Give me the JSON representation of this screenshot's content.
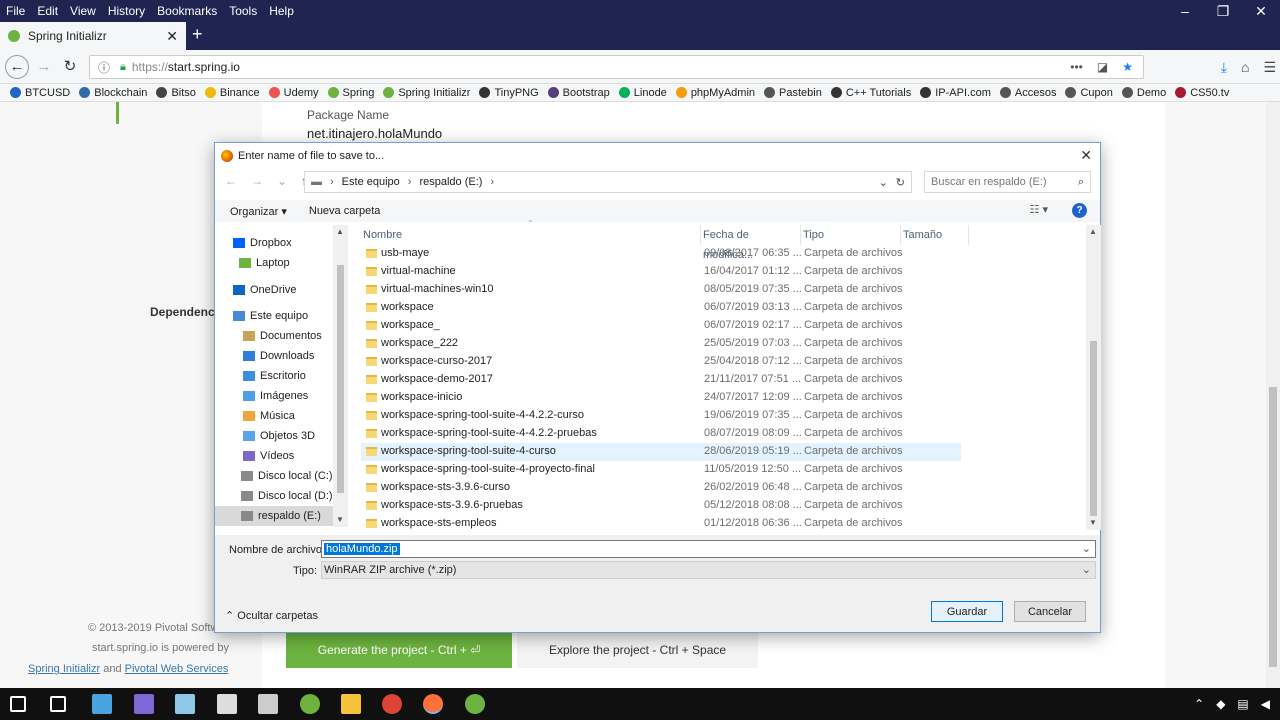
{
  "menu": [
    "File",
    "Edit",
    "View",
    "History",
    "Bookmarks",
    "Tools",
    "Help"
  ],
  "tab": {
    "title": "Spring Initializr"
  },
  "url": {
    "protocol": "https://",
    "host": "start.spring.io"
  },
  "bookmarks": [
    {
      "label": "BTCUSD",
      "color": "#1f64c8"
    },
    {
      "label": "Blockchain",
      "color": "#2e6da4"
    },
    {
      "label": "Bitso",
      "color": "#444444"
    },
    {
      "label": "Binance",
      "color": "#f0b90b"
    },
    {
      "label": "Udemy",
      "color": "#ec5252"
    },
    {
      "label": "Spring",
      "color": "#6db33f"
    },
    {
      "label": "Spring Initializr",
      "color": "#6db33f"
    },
    {
      "label": "TinyPNG",
      "color": "#333333"
    },
    {
      "label": "Bootstrap",
      "color": "#563d7c"
    },
    {
      "label": "Linode",
      "color": "#02b159"
    },
    {
      "label": "phpMyAdmin",
      "color": "#f89c0e"
    },
    {
      "label": "Pastebin",
      "color": "#555555"
    },
    {
      "label": "C++ Tutorials",
      "color": "#333333"
    },
    {
      "label": "IP-API.com",
      "color": "#333333"
    },
    {
      "label": "Accesos",
      "color": "#555555"
    },
    {
      "label": "Cupon",
      "color": "#555555"
    },
    {
      "label": "Demo",
      "color": "#555555"
    },
    {
      "label": "CS50.tv",
      "color": "#a51c30"
    }
  ],
  "page": {
    "package_label": "Package Name",
    "package_value": "net.itinajero.holaMundo",
    "dependencies": "Dependenc",
    "copyright": "© 2013-2019 Pivotal Softw",
    "powered": "start.spring.io is powered by",
    "link1": "Spring Initializr",
    "and": "and",
    "link2": "Pivotal Web Services",
    "generate": "Generate the project - Ctrl + ⏎",
    "explore": "Explore the project - Ctrl + Space"
  },
  "dialog": {
    "title": "Enter name of file to save to...",
    "breadcrumb": [
      "Este equipo",
      "respaldo (E:)"
    ],
    "search_placeholder": "Buscar en respaldo (E:)",
    "organize": "Organizar",
    "new_folder": "Nueva carpeta",
    "nav": [
      {
        "label": "Dropbox",
        "icon": "dropbox-icon",
        "color": "#0061ff"
      },
      {
        "label": "Laptop",
        "icon": "laptop-icon",
        "color": "#6db33f"
      },
      {
        "label": "OneDrive",
        "icon": "cloud-icon",
        "color": "#0a67c2"
      },
      {
        "label": "Este equipo",
        "icon": "computer-icon",
        "color": "#4a8ad4"
      },
      {
        "label": "Documentos",
        "icon": "documents-icon",
        "color": "#c7a45a"
      },
      {
        "label": "Downloads",
        "icon": "downloads-icon",
        "color": "#2e7fd5"
      },
      {
        "label": "Escritorio",
        "icon": "desktop-icon",
        "color": "#3c8ede"
      },
      {
        "label": "Imágenes",
        "icon": "pictures-icon",
        "color": "#4c9ee5"
      },
      {
        "label": "Música",
        "icon": "music-icon",
        "color": "#f0a640"
      },
      {
        "label": "Objetos 3D",
        "icon": "objects3d-icon",
        "color": "#58a6e8"
      },
      {
        "label": "Vídeos",
        "icon": "videos-icon",
        "color": "#7b68c8"
      },
      {
        "label": "Disco local (C:)",
        "icon": "drive-icon",
        "color": "#8a8a8a"
      },
      {
        "label": "Disco local (D:)",
        "icon": "drive-icon",
        "color": "#8a8a8a"
      },
      {
        "label": "respaldo (E:)",
        "icon": "drive-icon",
        "color": "#8a8a8a"
      }
    ],
    "columns": [
      "Nombre",
      "Fecha de modifica...",
      "Tipo",
      "Tamaño"
    ],
    "files": [
      {
        "name": "usb-maye",
        "date": "09/08/2017 06:35 ...",
        "type": "Carpeta de archivos"
      },
      {
        "name": "virtual-machine",
        "date": "16/04/2017 01:12 ...",
        "type": "Carpeta de archivos"
      },
      {
        "name": "virtual-machines-win10",
        "date": "08/05/2019 07:35 ...",
        "type": "Carpeta de archivos"
      },
      {
        "name": "workspace",
        "date": "06/07/2019 03:13 ...",
        "type": "Carpeta de archivos"
      },
      {
        "name": "workspace_",
        "date": "06/07/2019 02:17 ...",
        "type": "Carpeta de archivos"
      },
      {
        "name": "workspace_222",
        "date": "25/05/2019 07:03 ...",
        "type": "Carpeta de archivos"
      },
      {
        "name": "workspace-curso-2017",
        "date": "25/04/2018 07:12 ...",
        "type": "Carpeta de archivos"
      },
      {
        "name": "workspace-demo-2017",
        "date": "21/11/2017 07:51 ...",
        "type": "Carpeta de archivos"
      },
      {
        "name": "workspace-inicio",
        "date": "24/07/2017 12:09 ...",
        "type": "Carpeta de archivos"
      },
      {
        "name": "workspace-spring-tool-suite-4-4.2.2-curso",
        "date": "19/06/2019 07:35 ...",
        "type": "Carpeta de archivos"
      },
      {
        "name": "workspace-spring-tool-suite-4-4.2.2-pruebas",
        "date": "08/07/2019 08:09 ...",
        "type": "Carpeta de archivos"
      },
      {
        "name": "workspace-spring-tool-suite-4-curso",
        "date": "28/06/2019 05:19 ...",
        "type": "Carpeta de archivos"
      },
      {
        "name": "workspace-spring-tool-suite-4-proyecto-final",
        "date": "11/05/2019 12:50 ...",
        "type": "Carpeta de archivos"
      },
      {
        "name": "workspace-sts-3.9.6-curso",
        "date": "26/02/2019 06:48 ...",
        "type": "Carpeta de archivos"
      },
      {
        "name": "workspace-sts-3.9.6-pruebas",
        "date": "05/12/2018 08:08 ...",
        "type": "Carpeta de archivos"
      },
      {
        "name": "workspace-sts-empleos",
        "date": "01/12/2018 06:36 ...",
        "type": "Carpeta de archivos"
      }
    ],
    "filename_label": "Nombre de archivo:",
    "filename_value": "holaMundo.zip",
    "type_label": "Tipo:",
    "type_value": "WinRAR ZIP archive (*.zip)",
    "hide_folders": "Ocultar carpetas",
    "save": "Guardar",
    "cancel": "Cancelar"
  },
  "taskbar": [
    {
      "icon": "windows-start-icon",
      "color": "#ffffff"
    },
    {
      "icon": "task-view-icon",
      "color": "#ffffff"
    },
    {
      "icon": "control-panel-icon",
      "color": "#4aa3df"
    },
    {
      "icon": "network-icon",
      "color": "#7f68d6"
    },
    {
      "icon": "notepad-icon",
      "color": "#8fc7e8"
    },
    {
      "icon": "terminal-icon",
      "color": "#dddddd"
    },
    {
      "icon": "calculator-icon",
      "color": "#cccccc"
    },
    {
      "icon": "spring-tool-suite-icon",
      "color": "#6db33f"
    },
    {
      "icon": "file-explorer-icon",
      "color": "#f8c13a"
    },
    {
      "icon": "chrome-icon",
      "color": "#db4437"
    },
    {
      "icon": "firefox-icon",
      "color": "#ff7139"
    },
    {
      "icon": "spring-tool-suite-icon",
      "color": "#6db33f"
    }
  ]
}
